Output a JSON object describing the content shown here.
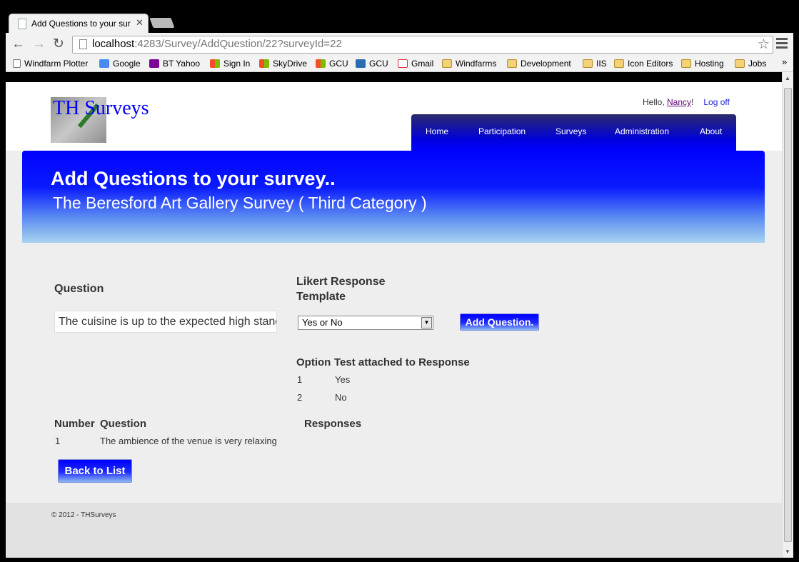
{
  "browser": {
    "tab_title": "Add Questions to your sur",
    "url_host": "localhost",
    "url_rest": ":4283/Survey/AddQuestion/22?surveyId=22",
    "bookmarks": [
      "Windfarm Plotter",
      "Google",
      "BT Yahoo",
      "Sign In",
      "SkyDrive",
      "GCU",
      "GCU",
      "Gmail",
      "Windfarms",
      "Development",
      "IIS",
      "Icon Editors",
      "Hosting",
      "Jobs"
    ],
    "bookmarks_more": "»"
  },
  "header": {
    "site_title": "TH Surveys",
    "greeting": "Hello, ",
    "user": "Nancy",
    "greeting_end": "!",
    "logoff": "Log off",
    "menu": [
      "Home",
      "Participation",
      "Surveys",
      "Administration",
      "About"
    ]
  },
  "banner": {
    "title": "Add Questions to your survey..",
    "subtitle": "The Beresford Art Gallery Survey ( Third Category )"
  },
  "form": {
    "question_label": "Question",
    "likert_label_line1": "Likert Response",
    "likert_label_line2": "Template",
    "question_value": "The cuisine is up to the expected high stand",
    "template_selected": "Yes or No",
    "add_button": "Add Question."
  },
  "options_table": {
    "headers": [
      "Option",
      "Test attached to Response"
    ],
    "rows": [
      [
        "1",
        "Yes"
      ],
      [
        "2",
        "No"
      ]
    ]
  },
  "questions_table": {
    "headers": [
      "Number",
      "Question",
      "Responses"
    ],
    "rows": [
      [
        "1",
        "The ambience of the venue is very relaxing",
        ""
      ]
    ]
  },
  "back_button": "Back to List",
  "footer": "© 2012 - THSurveys",
  "colors": {
    "accent": "#0000ff",
    "menu_dark": "#2b2b6b"
  }
}
